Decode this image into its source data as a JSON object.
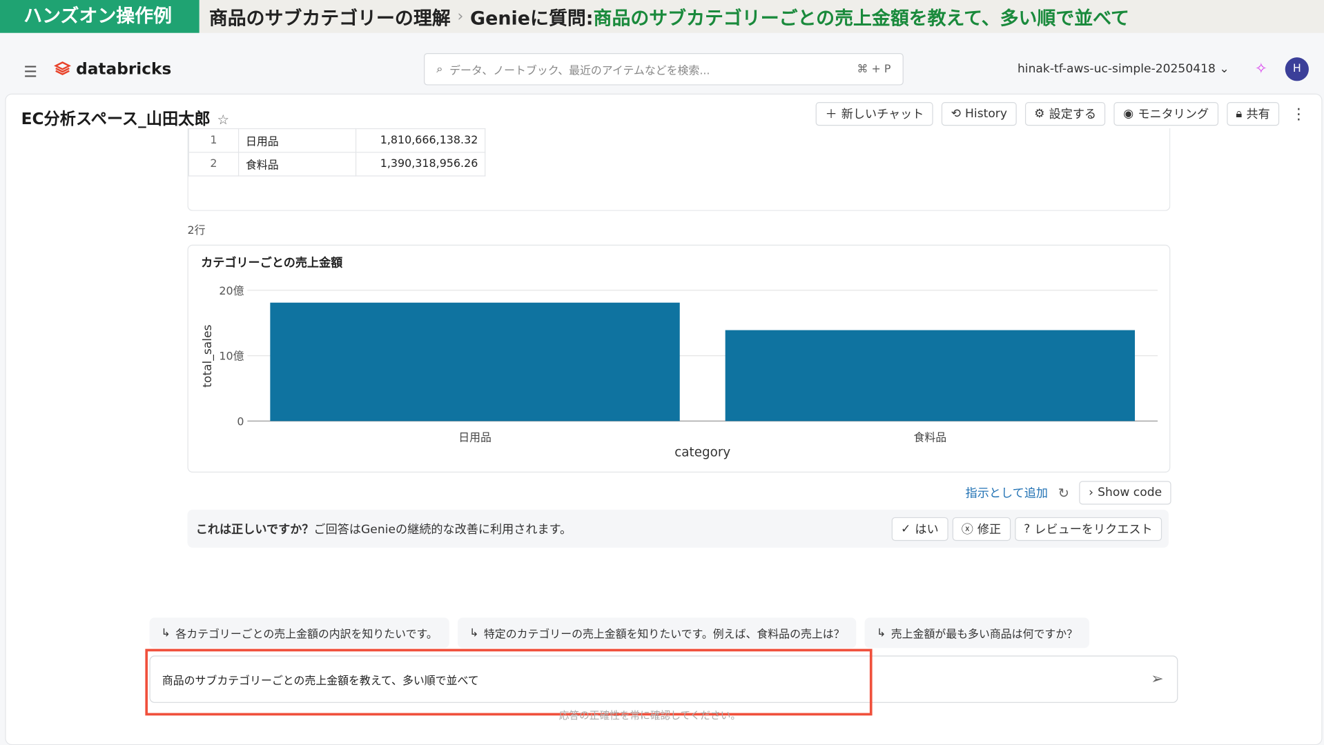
{
  "banner": {
    "tag": "ハンズオン操作例",
    "crumb1": "商品のサブカテゴリーの理解",
    "sep": "›",
    "prefix": "Genieに質問: ",
    "question": "商品のサブカテゴリーごとの売上金額を教えて、多い順で並べて"
  },
  "topbar": {
    "brand": "databricks",
    "search_placeholder": "データ、ノートブック、最近のアイテムなどを検索...",
    "shortcut": "⌘ + P",
    "workspace": "hinak-tf-aws-uc-simple-20250418",
    "avatar": "H"
  },
  "space": {
    "title": "EC分析スペース_山田太郎",
    "buttons": {
      "new_chat": "新しいチャット",
      "history": "History",
      "settings": "設定する",
      "monitoring": "モニタリング",
      "share": "共有"
    }
  },
  "table": {
    "rows": [
      {
        "n": "1",
        "category": "日用品",
        "total": "1,810,666,138.32"
      },
      {
        "n": "2",
        "category": "食料品",
        "total": "1,390,318,956.26"
      }
    ],
    "row_count": "2行"
  },
  "chart_data": {
    "type": "bar",
    "title": "カテゴリーごとの売上金額",
    "categories": [
      "日用品",
      "食料品"
    ],
    "values": [
      1810666138.32,
      1390318956.26
    ],
    "xlabel": "category",
    "ylabel": "total_sales",
    "ylim": [
      0,
      2000000000
    ],
    "yticks": [
      {
        "v": 0,
        "label": "0"
      },
      {
        "v": 1000000000,
        "label": "10億"
      },
      {
        "v": 2000000000,
        "label": "20億"
      }
    ],
    "color": "#0f73a0",
    "grid": true
  },
  "actions": {
    "add_instruction": "指示として追加",
    "show_code": "Show code"
  },
  "feedback": {
    "question": "これは正しいですか？",
    "note": "ご回答はGenieの継続的な改善に利用されます。",
    "yes": "はい",
    "fix": "修正",
    "review": "レビューをリクエスト"
  },
  "suggestions": [
    "各カテゴリーごとの売上金額の内訳を知りたいです。",
    "特定のカテゴリーの売上金額を知りたいです。例えば、食料品の売上は？",
    "売上金額が最も多い商品は何ですか？"
  ],
  "input": {
    "value": "商品のサブカテゴリーごとの売上金額を教えて、多い順で並べて",
    "disclaimer": "応答の正確性を常に確認してください。"
  }
}
